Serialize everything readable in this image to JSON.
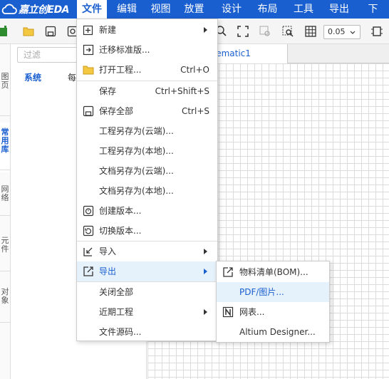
{
  "app": {
    "logo_text": "嘉立创EDA"
  },
  "menubar": {
    "items": [
      {
        "label": "文件",
        "active": true
      },
      {
        "label": "编辑"
      },
      {
        "label": "视图"
      },
      {
        "label": "放置"
      },
      {
        "label": "设计"
      },
      {
        "label": "布局"
      },
      {
        "label": "工具"
      },
      {
        "label": "导出"
      },
      {
        "label": "下"
      }
    ]
  },
  "toolbar": {
    "zoom_value": "0.05"
  },
  "left_tabs": {
    "items": [
      {
        "label": "图\n页",
        "active": false
      },
      {
        "label": "常\n用\n库",
        "active": true
      },
      {
        "label": "网\n络",
        "active": false
      },
      {
        "label": "元\n件",
        "active": false
      },
      {
        "label": "对\n象",
        "active": false
      }
    ]
  },
  "library": {
    "filter_placeholder": "过滤",
    "subtabs": [
      {
        "label": "系统",
        "active": true
      },
      {
        "label": "每"
      }
    ]
  },
  "document": {
    "tab_title": "chematic1"
  },
  "file_menu": {
    "items": [
      {
        "icon": "new-file-icon",
        "label": "新建",
        "submenu": true
      },
      {
        "icon": "migrate-icon",
        "label": "迁移标准版..."
      },
      {
        "icon": "folder-icon",
        "label": "打开工程...",
        "shortcut": "Ctrl+O"
      },
      {
        "icon": "",
        "label": "保存",
        "shortcut": "Ctrl+Shift+S"
      },
      {
        "icon": "save-all-icon",
        "label": "保存全部",
        "shortcut": "Ctrl+S"
      },
      {
        "icon": "",
        "label": "工程另存为(云端)..."
      },
      {
        "icon": "",
        "label": "工程另存为(本地)..."
      },
      {
        "icon": "",
        "label": "文档另存为(云端)..."
      },
      {
        "icon": "",
        "label": "文档另存为(本地)..."
      },
      {
        "icon": "create-version-icon",
        "label": "创建版本..."
      },
      {
        "icon": "switch-version-icon",
        "label": "切换版本..."
      },
      {
        "icon": "import-icon",
        "label": "导入",
        "submenu": true
      },
      {
        "icon": "export-icon",
        "label": "导出",
        "submenu": true,
        "highlighted": true
      },
      {
        "icon": "",
        "label": "关闭全部"
      },
      {
        "icon": "",
        "label": "近期工程",
        "submenu": true
      },
      {
        "icon": "",
        "label": "文件源码..."
      }
    ]
  },
  "export_menu": {
    "items": [
      {
        "icon": "bom-export-icon",
        "label": "物料清单(BOM)..."
      },
      {
        "icon": "",
        "label": "PDF/图片...",
        "highlighted": true
      },
      {
        "icon": "netlist-icon",
        "label": "网表..."
      },
      {
        "icon": "",
        "label": "Altium Designer..."
      }
    ]
  },
  "colors": {
    "brand": "#1a5fd0",
    "highlight": "#e5f1fb"
  }
}
